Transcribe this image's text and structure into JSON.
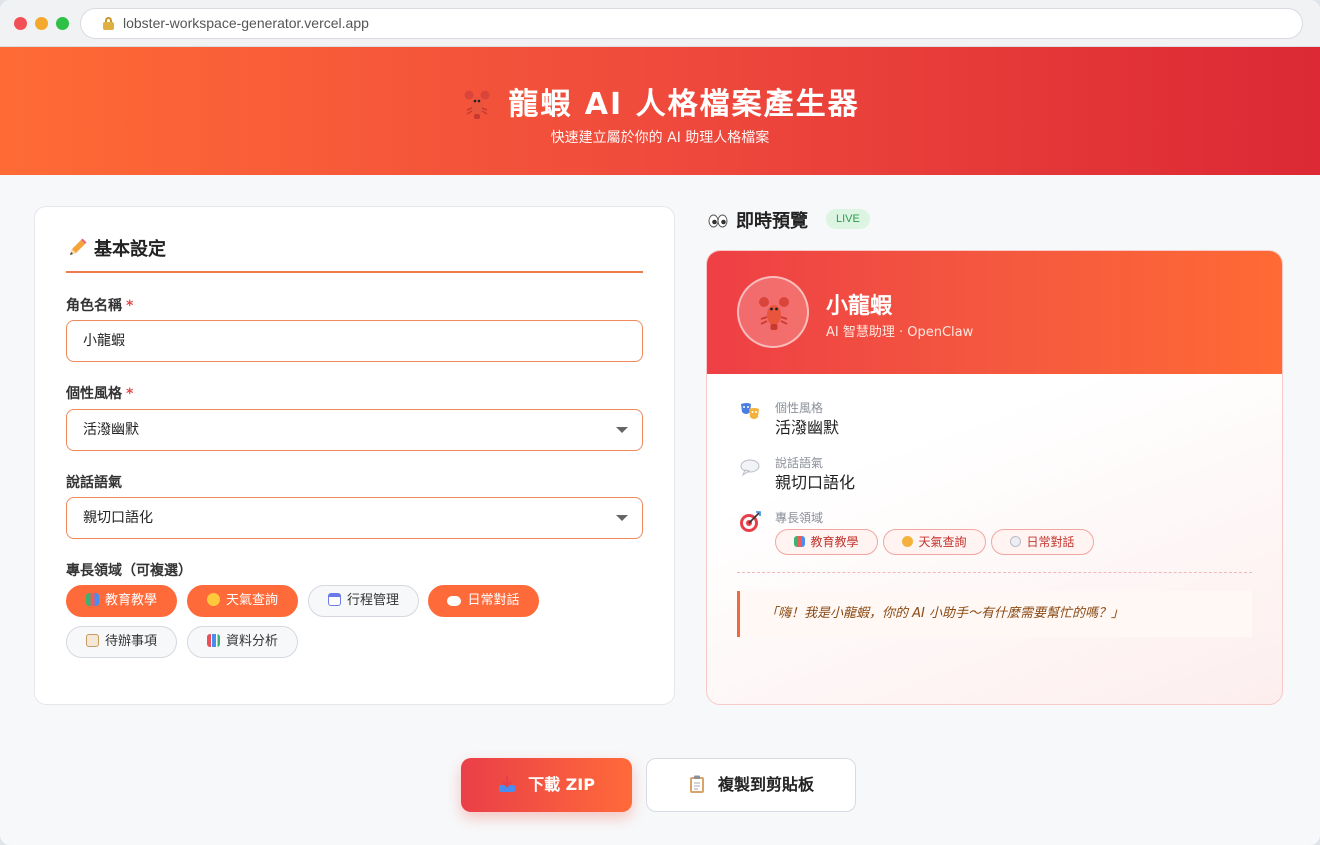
{
  "browser": {
    "url": "lobster-workspace-generator.vercel.app"
  },
  "header": {
    "title": "龍蝦 AI 人格檔案產生器",
    "subtitle": "快速建立屬於你的 AI 助理人格檔案",
    "logo_icon": "lobster-icon"
  },
  "form": {
    "section_title": "基本設定",
    "section_icon": "pencil-icon",
    "name": {
      "label": "角色名稱",
      "required_mark": "*",
      "value": "小龍蝦"
    },
    "personality": {
      "label": "個性風格",
      "required_mark": "*",
      "selected": "活潑幽默"
    },
    "tone": {
      "label": "說話語氣",
      "selected": "親切口語化"
    },
    "expertise": {
      "label": "專長領域（可複選）",
      "options": [
        {
          "label": "教育教學",
          "selected": true,
          "icon": "books-icon"
        },
        {
          "label": "天氣查詢",
          "selected": true,
          "icon": "sun-icon"
        },
        {
          "label": "行程管理",
          "selected": false,
          "icon": "calendar-icon"
        },
        {
          "label": "日常對話",
          "selected": true,
          "icon": "speech-bubble-icon"
        },
        {
          "label": "待辦事項",
          "selected": false,
          "icon": "memo-icon"
        },
        {
          "label": "資料分析",
          "selected": false,
          "icon": "bar-chart-icon"
        }
      ]
    }
  },
  "preview": {
    "heading": "即時預覽",
    "heading_icon": "eyes-icon",
    "badge": "LIVE",
    "card": {
      "name": "小龍蝦",
      "subtitle": "AI 智慧助理 · OpenClaw",
      "avatar_icon": "lobster-icon",
      "personality_label": "個性風格",
      "personality_value": "活潑幽默",
      "tone_label": "說話語氣",
      "tone_value": "親切口語化",
      "expertise_label": "專長領域",
      "tags": [
        "教育教學",
        "天氣查詢",
        "日常對話"
      ],
      "greeting": "「嗨！我是小龍蝦，你的 AI 小助手～有什麼需要幫忙的嗎？」"
    }
  },
  "actions": {
    "download_label": "下載 ZIP",
    "copy_label": "複製到剪貼板"
  },
  "colors": {
    "accent": "#ff6a3a",
    "banner_start": "#ff6b35",
    "banner_end": "#dc2935",
    "live_green": "#2e9a4e"
  }
}
